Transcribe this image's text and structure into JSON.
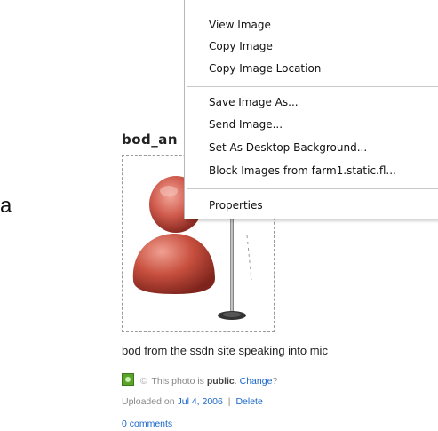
{
  "page": {
    "left_fragment": "a",
    "photo_title": "bod_an",
    "caption": "bod from the ssdn site speaking into mic",
    "privacy": {
      "prefix": "This photo is",
      "status": "public",
      "change_link": "Change",
      "suffix": "?"
    },
    "upload": {
      "prefix": "Uploaded on",
      "date_link": "Jul 4, 2006",
      "divider": "|",
      "delete_link": "Delete"
    },
    "comments_link": "0 comments",
    "icons": {
      "public": "public-status-icon",
      "globe": "copyright-globe-icon"
    },
    "colors": {
      "link": "#1966c8",
      "avatar": "#c0504d",
      "public_badge": "#5aa32d"
    }
  },
  "context_menu": {
    "items": [
      {
        "label": "View Image"
      },
      {
        "label": "Copy Image"
      },
      {
        "label": "Copy Image Location"
      },
      {
        "label": "Save Image As..."
      },
      {
        "label": "Send Image..."
      },
      {
        "label": "Set As Desktop Background..."
      },
      {
        "label": "Block Images from farm1.static.fl..."
      },
      {
        "label": "Properties"
      }
    ]
  }
}
